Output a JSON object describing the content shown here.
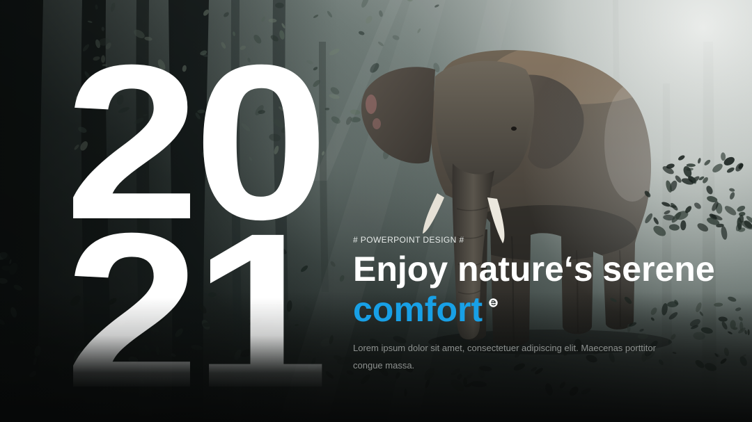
{
  "slide": {
    "year_top": "20",
    "year_bottom": "21",
    "kicker": "# POWERPOINT DESIGN #",
    "headline": {
      "line1": "Enjoy nature‘s serene",
      "accent": "comfort",
      "accent_icon": "circle-badge-icon"
    },
    "body_lines": [
      "Lorem ipsum dolor sit amet, consectetuer adipiscing elit. Maecenas porttitor",
      "congue massa."
    ]
  },
  "colors": {
    "title": "#ffffff",
    "accent": "#18a0e6",
    "kicker": "#e6eae8",
    "body": "#8d918f"
  }
}
